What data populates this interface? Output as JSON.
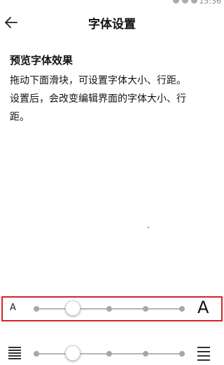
{
  "status_bar": {
    "time": "15:36"
  },
  "header": {
    "title": "字体设置"
  },
  "preview": {
    "heading": "预览字体效果",
    "lines": [
      "拖动下面滑块，可设置字体大小、行距。",
      "设置后，会改变编辑界面的字体大小、行",
      "距。"
    ]
  },
  "font_size_slider": {
    "small_label": "A",
    "large_label": "A",
    "steps": 5,
    "selected_index": 1
  },
  "line_spacing_slider": {
    "steps": 5,
    "selected_index": 1
  },
  "colors": {
    "highlight": "#d0242a",
    "track": "#b5b5b5"
  }
}
